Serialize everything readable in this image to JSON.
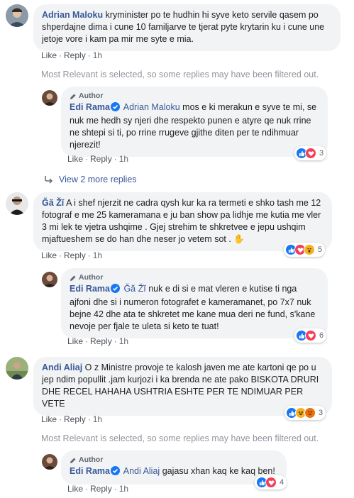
{
  "actions": {
    "like": "Like",
    "reply": "Reply",
    "sep": "·"
  },
  "filter_note": "Most Relevant is selected, so some replies may have been filtered out.",
  "author_tag": "Author",
  "comments": [
    {
      "author": "Adrian Maloku",
      "text": "kryminister po te hudhin hi syve keto servile qasem po shperdajne dima i cune 10 familjarve te tjerat pyte krytarin ku i cune une jetoje vore i kam pa mir me syte e mia.",
      "time": "1h"
    },
    {
      "author": "Edi Rama",
      "mention": "Adrian Maloku",
      "text": "mos e ki merakun e syve te mi, se nuk me hedh sy njeri dhe respekto punen e atyre qe nuk rrine ne shtepi si ti, po rrine rrugeve gjithe diten per te ndihmuar njerezit!",
      "time": "1h",
      "reaction_count": "3"
    },
    {
      "view_more": "View 2 more replies"
    },
    {
      "author": "Ğă Žĭ",
      "text": "A i shef njerzit ne cadra qysh kur ka ra termeti e shko tash me 12 fotograf e me 25 kameramana e ju ban show pa lidhje me kutia me vler 3 mi lek te vjetra ushqime . Gjej strehim te shkretvee e jepu ushqim mjaftueshem se do han dhe neser jo vetem sot .",
      "emoji": "✋",
      "time": "1h",
      "reaction_count": "5"
    },
    {
      "author": "Edi Rama",
      "mention": "Ğă Žĭ",
      "text": "nuk e di si e mat vleren e kutise ti nga ajfoni dhe si i numeron fotografet e kameramanet, po 7x7 nuk bejne 42 dhe ata te shkretet me kane mua deri ne fund, s'kane nevoje per fjale te uleta si keto te tuat!",
      "time": "1h",
      "reaction_count": "6"
    },
    {
      "author": "Andi Aliaj",
      "text": "O z Ministre provoje te kalosh javen me ate kartoni qe po u jep ndim popullit .jam kurjozi i ka brenda ne ate pako BISKOTA DRURI DHE RECEL HAHAHA USHTRIA ESHTE PER TE NDIMUAR PER VETE",
      "time": "1h",
      "reaction_count": "3"
    },
    {
      "author": "Edi Rama",
      "mention": "Andi Aliaj",
      "text": "gajasu xhan kaq ke kaq ben!",
      "time": "1h",
      "reaction_count": "4"
    }
  ],
  "colors": {
    "like": "#1877f2",
    "love": "#f33e58",
    "haha": "#f7b125",
    "angry": "#e9710f",
    "link": "#385898"
  },
  "icons": {
    "verified": "verified-badge-icon",
    "pencil": "pencil-icon",
    "reply_arrow": "reply-arrow-icon"
  }
}
